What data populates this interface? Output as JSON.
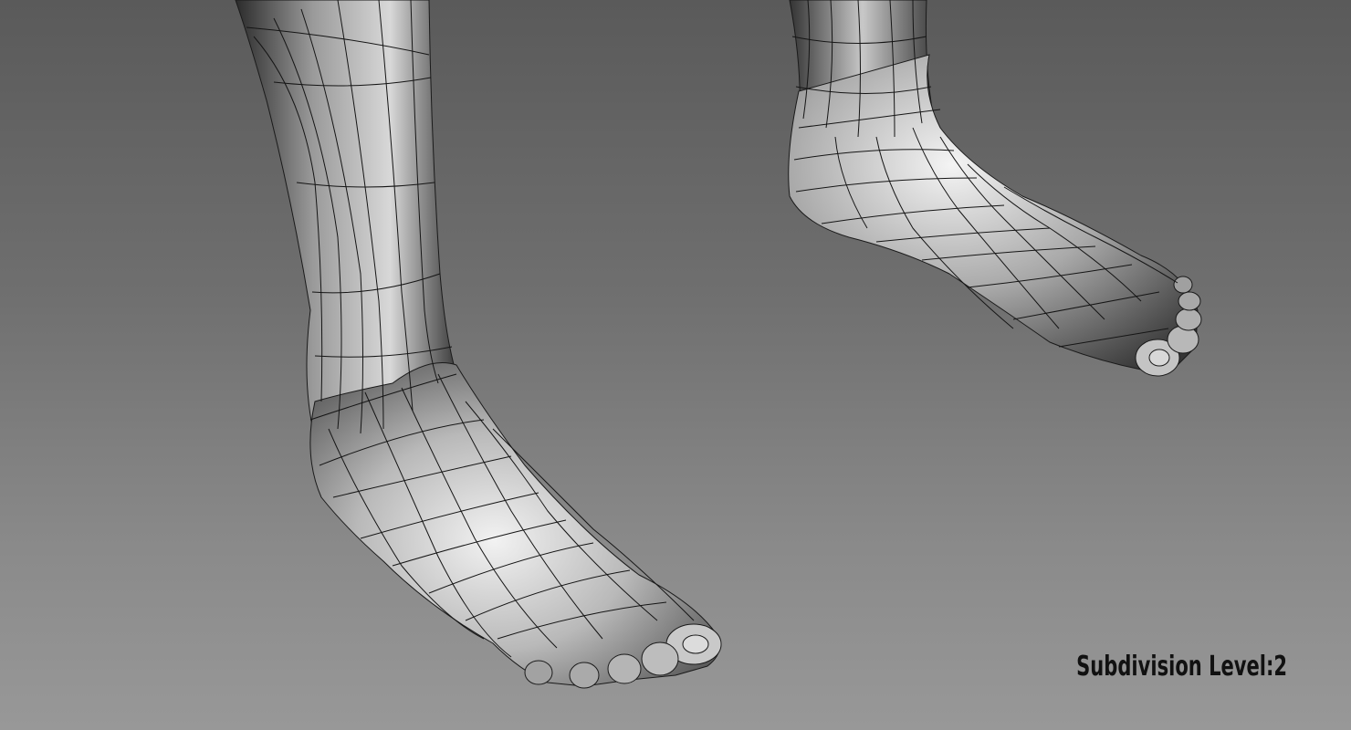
{
  "viewport": {
    "background_top": "#5a5a5a",
    "background_bottom": "#989898",
    "mesh_line_color": "#1a1a1a",
    "overlay_label": "Subdivision Level:2"
  }
}
